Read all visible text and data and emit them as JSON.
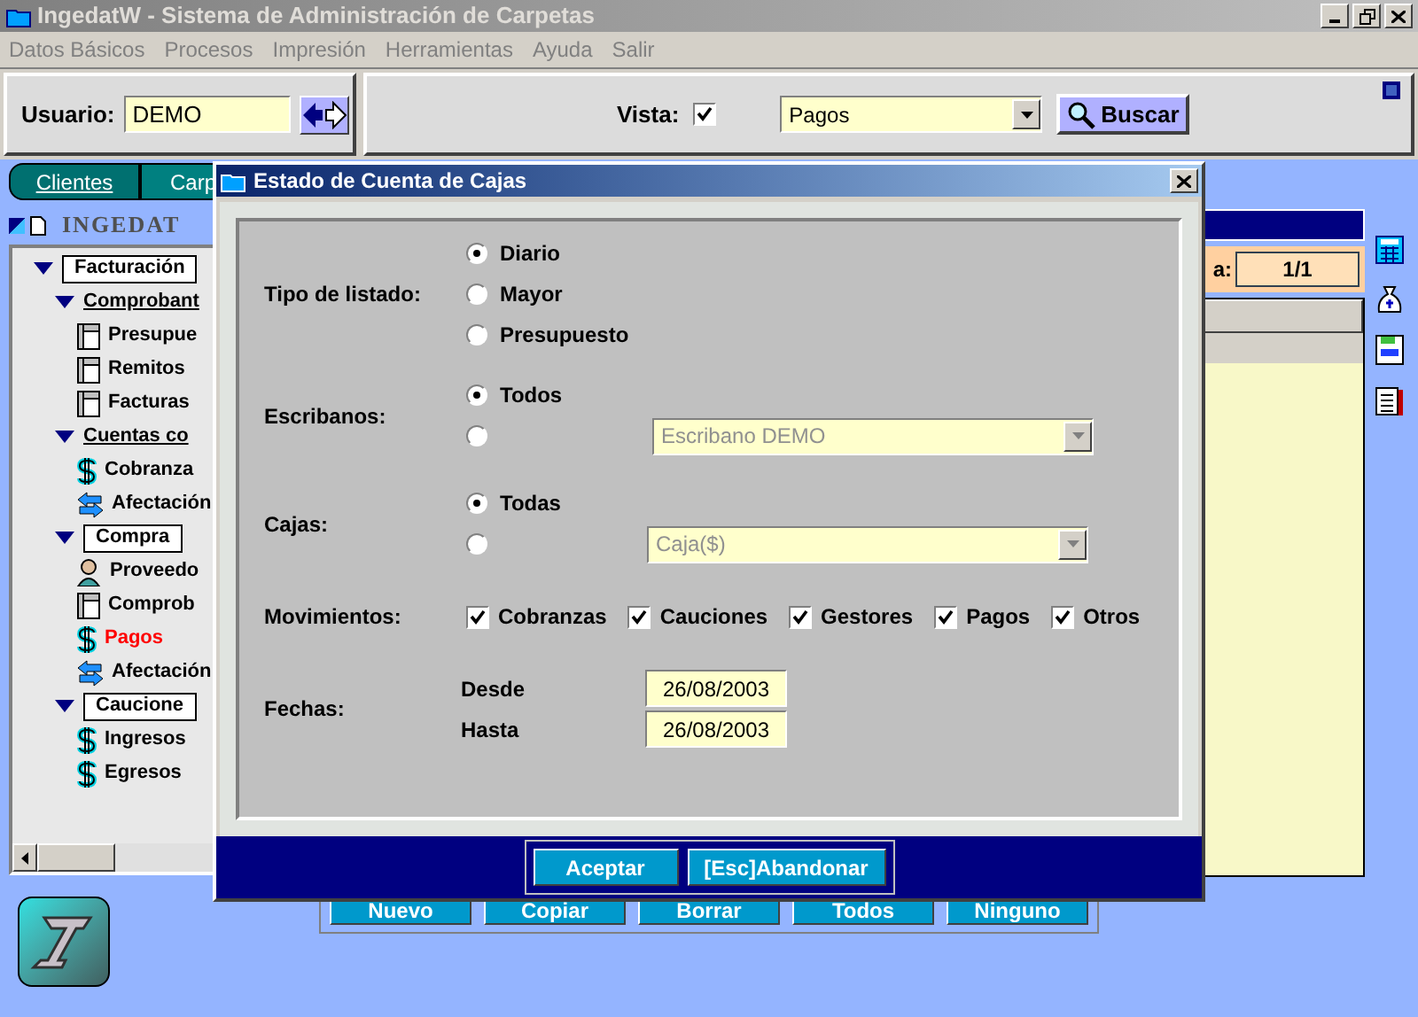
{
  "window": {
    "title": "IngedatW - Sistema de Administración de Carpetas"
  },
  "menu": [
    "Datos Básicos",
    "Procesos",
    "Impresión",
    "Herramientas",
    "Ayuda",
    "Salir"
  ],
  "toolbar": {
    "user_label": "Usuario:",
    "user_value": "DEMO",
    "view_label": "Vista:",
    "view_checked": true,
    "view_select": "Pagos",
    "search_button": "Buscar"
  },
  "sidebar": {
    "tabs": [
      {
        "label": "Clientes",
        "selected": true
      },
      {
        "label": "Carp",
        "selected": false
      }
    ],
    "header": "INGEDAT",
    "tree": [
      {
        "label": "Facturación",
        "kind": "box",
        "expanded": true,
        "children": [
          {
            "label": "Comprobant",
            "kind": "group",
            "expanded": true,
            "children": [
              {
                "label": "Presupue",
                "kind": "document",
                "selected": false
              },
              {
                "label": "Remitos",
                "kind": "document",
                "selected": false
              },
              {
                "label": "Facturas",
                "kind": "document",
                "selected": false
              }
            ]
          },
          {
            "label": "Cuentas co",
            "kind": "group",
            "expanded": true,
            "children": [
              {
                "label": "Cobranza",
                "kind": "money",
                "selected": false
              },
              {
                "label": "Afectación",
                "kind": "transfer",
                "selected": false
              }
            ]
          },
          {
            "label": "Compra",
            "kind": "box",
            "expanded": true,
            "children": [
              {
                "label": "Proveedo",
                "kind": "person",
                "selected": false
              },
              {
                "label": "Comprob",
                "kind": "document",
                "selected": false
              },
              {
                "label": "Pagos",
                "kind": "money",
                "selected": true
              },
              {
                "label": "Afectación",
                "kind": "transfer",
                "selected": false
              }
            ]
          },
          {
            "label": "Caucione",
            "kind": "box",
            "expanded": true,
            "children": [
              {
                "label": "Ingresos",
                "kind": "money",
                "selected": false
              },
              {
                "label": "Egresos",
                "kind": "money",
                "selected": false
              }
            ]
          }
        ]
      }
    ]
  },
  "main": {
    "page_label": "a:",
    "page_value": "1/1",
    "buttons": [
      "Nuevo",
      "Copiar",
      "Borrar",
      "Todos",
      "Ninguno"
    ]
  },
  "dialog": {
    "title": "Estado de Cuenta de Cajas",
    "tipo": {
      "label": "Tipo de listado:",
      "options": [
        {
          "label": "Diario",
          "selected": true
        },
        {
          "label": "Mayor",
          "selected": false
        },
        {
          "label": "Presupuesto",
          "selected": false
        }
      ]
    },
    "escribanos": {
      "label": "Escribanos:",
      "all_label": "Todos",
      "all_selected": true,
      "select": "Escribano DEMO",
      "disabled": true
    },
    "cajas": {
      "label": "Cajas:",
      "all_label": "Todas",
      "all_selected": true,
      "select": "Caja($)",
      "disabled": true
    },
    "movimientos": {
      "label": "Movimientos:",
      "options": [
        {
          "label": "Cobranzas",
          "checked": true
        },
        {
          "label": "Cauciones",
          "checked": true
        },
        {
          "label": "Gestores",
          "checked": true
        },
        {
          "label": "Pagos",
          "checked": true
        },
        {
          "label": "Otros",
          "checked": true
        }
      ]
    },
    "fechas": {
      "label": "Fechas:",
      "from_label": "Desde",
      "from": "26/08/2003",
      "to_label": "Hasta",
      "to": "26/08/2003"
    },
    "buttons": [
      "Aceptar",
      "[Esc]Abandonar"
    ]
  }
}
